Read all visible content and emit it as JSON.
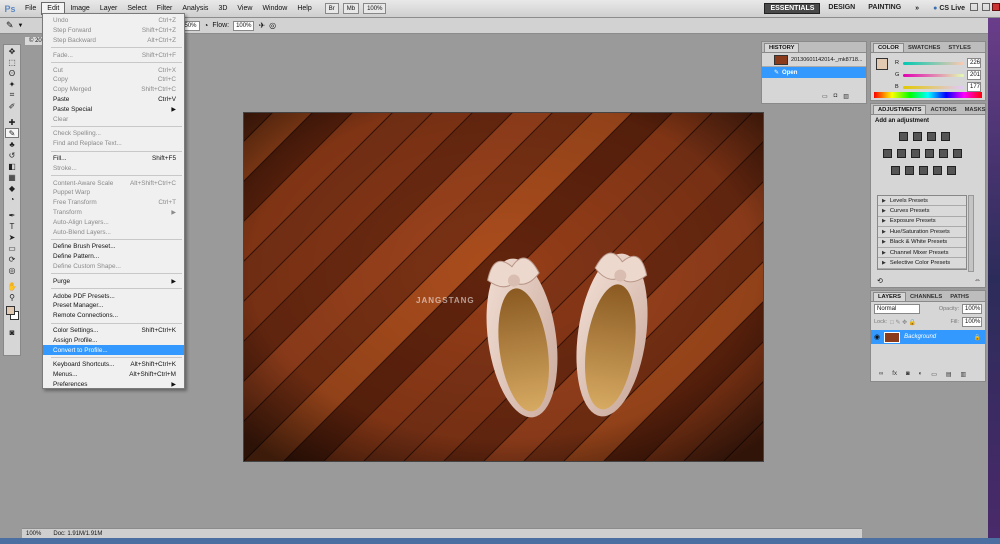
{
  "app": {
    "logo": "Ps",
    "menu": [
      "File",
      "Edit",
      "Image",
      "Layer",
      "Select",
      "Filter",
      "Analysis",
      "3D",
      "View",
      "Window",
      "Help"
    ],
    "active_menu": "Edit",
    "zoom_box": "100%",
    "workspaces": [
      "ESSENTIALS",
      "DESIGN",
      "PAINTING"
    ],
    "workspace_more": "»",
    "cslive": "CS Live"
  },
  "options_bar": {
    "opacity_value": "50%",
    "flow_label": "Flow:",
    "flow_value": "100%"
  },
  "document": {
    "tab_label": "© 201",
    "watermark": "JANGSTANG",
    "status_zoom": "100%",
    "status_doc": "Doc: 1.91M/1.91M"
  },
  "edit_menu": [
    {
      "label": "Undo",
      "shortcut": "Ctrl+Z",
      "disabled": true
    },
    {
      "label": "Step Forward",
      "shortcut": "Shift+Ctrl+Z",
      "disabled": true
    },
    {
      "label": "Step Backward",
      "shortcut": "Alt+Ctrl+Z",
      "disabled": true
    },
    {
      "sep": true
    },
    {
      "label": "Fade...",
      "shortcut": "Shift+Ctrl+F",
      "disabled": true
    },
    {
      "sep": true
    },
    {
      "label": "Cut",
      "shortcut": "Ctrl+X",
      "disabled": true
    },
    {
      "label": "Copy",
      "shortcut": "Ctrl+C",
      "disabled": true
    },
    {
      "label": "Copy Merged",
      "shortcut": "Shift+Ctrl+C",
      "disabled": true
    },
    {
      "label": "Paste",
      "shortcut": "Ctrl+V",
      "disabled": false
    },
    {
      "label": "Paste Special",
      "arrow": true,
      "disabled": false
    },
    {
      "label": "Clear",
      "disabled": true
    },
    {
      "sep": true
    },
    {
      "label": "Check Spelling...",
      "disabled": true
    },
    {
      "label": "Find and Replace Text...",
      "disabled": true
    },
    {
      "sep": true
    },
    {
      "label": "Fill...",
      "shortcut": "Shift+F5",
      "disabled": false
    },
    {
      "label": "Stroke...",
      "disabled": true
    },
    {
      "sep": true
    },
    {
      "label": "Content-Aware Scale",
      "shortcut": "Alt+Shift+Ctrl+C",
      "disabled": true
    },
    {
      "label": "Puppet Warp",
      "disabled": true
    },
    {
      "label": "Free Transform",
      "shortcut": "Ctrl+T",
      "disabled": true
    },
    {
      "label": "Transform",
      "arrow": true,
      "disabled": true
    },
    {
      "label": "Auto-Align Layers...",
      "disabled": true
    },
    {
      "label": "Auto-Blend Layers...",
      "disabled": true
    },
    {
      "sep": true
    },
    {
      "label": "Define Brush Preset...",
      "disabled": false
    },
    {
      "label": "Define Pattern...",
      "disabled": false
    },
    {
      "label": "Define Custom Shape...",
      "disabled": true
    },
    {
      "sep": true
    },
    {
      "label": "Purge",
      "arrow": true,
      "disabled": false
    },
    {
      "sep": true
    },
    {
      "label": "Adobe PDF Presets...",
      "disabled": false
    },
    {
      "label": "Preset Manager...",
      "disabled": false
    },
    {
      "label": "Remote Connections...",
      "disabled": false
    },
    {
      "sep": true
    },
    {
      "label": "Color Settings...",
      "shortcut": "Shift+Ctrl+K",
      "disabled": false
    },
    {
      "label": "Assign Profile...",
      "disabled": false
    },
    {
      "label": "Convert to Profile...",
      "disabled": false,
      "selected": true
    },
    {
      "sep": true
    },
    {
      "label": "Keyboard Shortcuts...",
      "shortcut": "Alt+Shift+Ctrl+K",
      "disabled": false
    },
    {
      "label": "Menus...",
      "shortcut": "Alt+Shift+Ctrl+M",
      "disabled": false
    },
    {
      "label": "Preferences",
      "arrow": true,
      "disabled": false
    }
  ],
  "history": {
    "tab": "HISTORY",
    "snapshot_name": "20130601142014-_mk8718...",
    "step": "Open"
  },
  "color": {
    "tabs": [
      "COLOR",
      "SWATCHES",
      "STYLES"
    ],
    "r_label": "R",
    "r_value": "226",
    "g_label": "G",
    "g_value": "201",
    "b_label": "B",
    "b_value": "177",
    "fg_color": "#e2c9b1"
  },
  "adjustments": {
    "tabs": [
      "ADJUSTMENTS",
      "ACTIONS",
      "MASKS"
    ],
    "heading": "Add an adjustment",
    "presets": [
      "Levels Presets",
      "Curves Presets",
      "Exposure Presets",
      "Hue/Saturation Presets",
      "Black & White Presets",
      "Channel Mixer Presets",
      "Selective Color Presets"
    ]
  },
  "layers": {
    "tabs": [
      "LAYERS",
      "CHANNELS",
      "PATHS"
    ],
    "blend_mode": "Normal",
    "opacity_label": "Opacity:",
    "opacity_value": "100%",
    "lock_label": "Lock:",
    "fill_label": "Fill:",
    "fill_value": "100%",
    "layer_name": "Background"
  },
  "colors": {
    "selection": "#3399ff",
    "canvas_dark": "#5a2410",
    "canvas_light": "#b04a22"
  }
}
